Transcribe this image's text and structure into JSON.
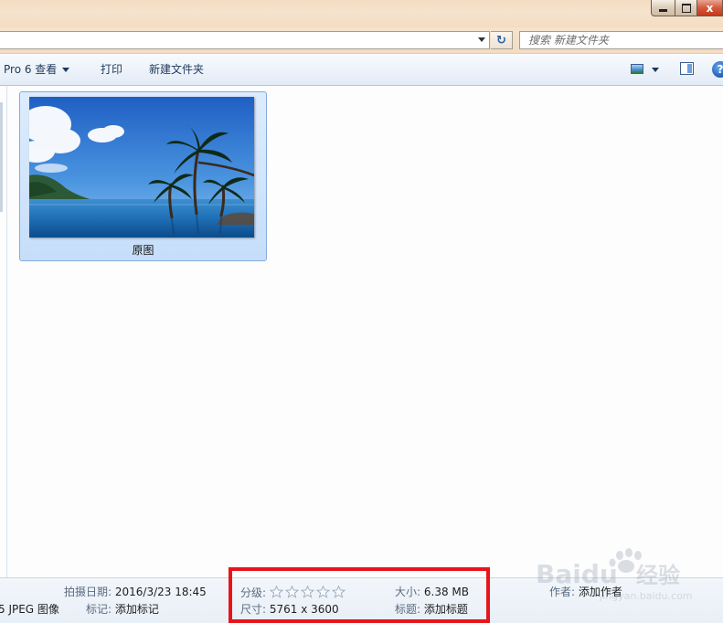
{
  "address": {
    "search_placeholder": "搜索 新建文件夹",
    "refresh_glyph": "↻"
  },
  "command_bar": {
    "open_with_label": "Pro 6 查看",
    "print_label": "打印",
    "new_folder_label": "新建文件夹",
    "help_glyph": "?"
  },
  "files": [
    {
      "name": "原图",
      "selected": true
    }
  ],
  "details": {
    "file_type": "5 JPEG 图像",
    "date_taken_label": "拍摄日期:",
    "date_taken_value": "2016/3/23 18:45",
    "tags_label": "标记:",
    "tags_value": "添加标记",
    "rating_label": "分级:",
    "rating_stars": 0,
    "rating_max": 5,
    "dimensions_label": "尺寸:",
    "dimensions_value": "5761 x 3600",
    "size_label": "大小:",
    "size_value": "6.38 MB",
    "title_label": "标题:",
    "title_value": "添加标题",
    "author_label": "作者:",
    "author_value": "添加作者"
  },
  "watermark": {
    "brand": "Baidu",
    "suffix": "经验",
    "url": "jingyan.baidu.com"
  },
  "colors": {
    "highlight": "#e8141b",
    "selection": "#c6defa",
    "selection_border": "#84acdd",
    "command_text": "#1e395b"
  },
  "caption_buttons": {
    "close_glyph": "x"
  }
}
